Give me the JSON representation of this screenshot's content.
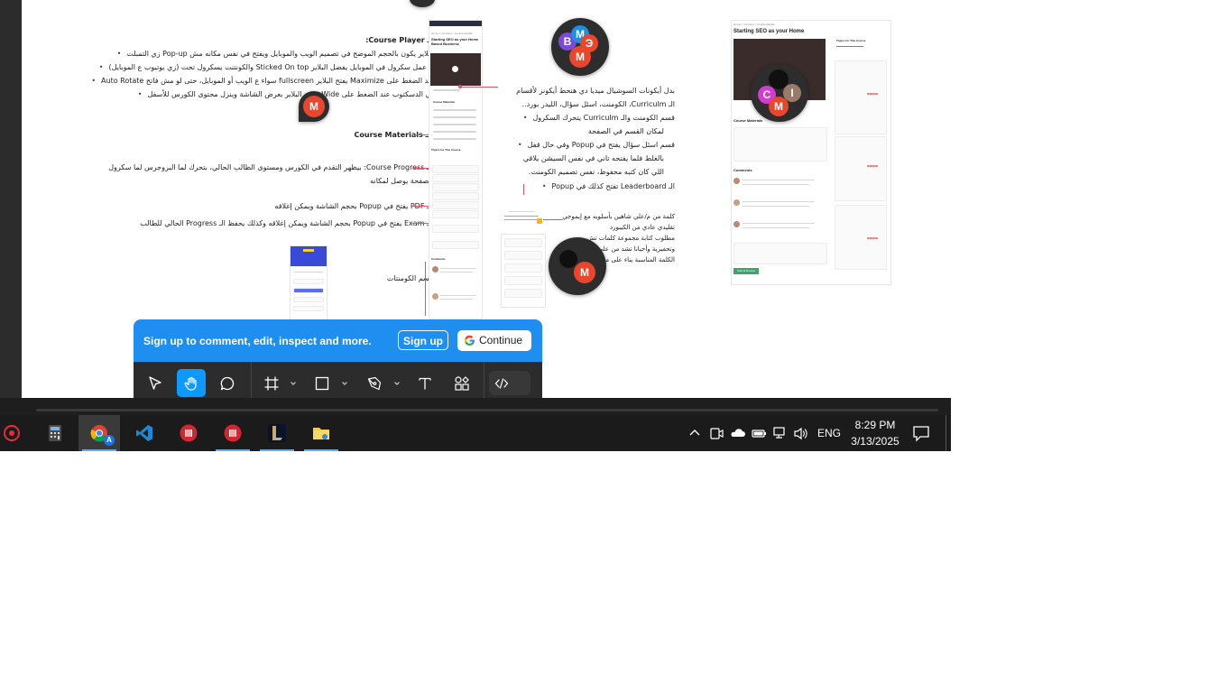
{
  "canvas": {
    "left_notes": {
      "course_player_heading": "الـ Course Player:",
      "course_player_bullets": [
        "البلاير يكون بالحجم الموضح في تصميم الويب والموبايل ويفتح في نفس مكانه مش Pop-up زي التمبلت",
        "لو عمل سكرول في الموبايل يفضل البلاير Sticked On top والكونتنت يسكرول تحت (زي يوتيوب ع الموبايل)",
        "عند الضغط على Maximize يفتح البلاير fullscreen سواء ع الويب أو الموبايل، حتى لو مش فاتح Auto Rotate",
        "في الدسكتوب عند الضغط على Wide يخلي البلاير بعرض الشاشة وينزل محتوى الكورس للأسفل"
      ],
      "course_materials": "الـ Course Materials",
      "course_progress_line1": "الـ Course Progress: بيظهر التقدم في الكورس ومستوى الطالب الحالي، بتحرك لما البروجرس لما سكرول",
      "course_progress_line2": "الصفحة يوصل لمكانه",
      "pdf_note": "الـ PDF يفتح في Popup بحجم الشاشة ويمكن إغلاقه",
      "exam_note": "الـ Exam يفتح في Popup بحجم الشاشة ويمكن إغلاقه وكذلك يحفظ الـ Progress الحالي للطالب",
      "comments_section": "قسم الكومنتات"
    },
    "right_notes": {
      "intro_line1": "بدل أيكونات السوشيال ميديا دي هنحط أيكونز لأقسام",
      "intro_line2": "الـ Curriculm، الكومنت، اسئل سؤال، الليدر بورد..",
      "bullets": [
        "قسم الكومنت والـ Curriculm يتحرك السكرول",
        "لمكان القسم في الصفحة",
        "قسم اسئل سؤال يفتح في Popup وفي حال قفل",
        "بالغلط فلما يفتحه تاني في نفس السيشن يلاقي",
        "اللي كان كتبه محفوظ، نفس تصميم الكومنت.",
        "الـ Leaderboard تفتح كذلك في Popup"
      ],
      "badge_note_line1": "كلمة من م/علي شاهين بأسلوبه مع إيموجي",
      "badge_note_line2": "تقليدي عادي من الكيبورد",
      "badge_note_line3": "مطلوب كتابة مجموعة كلمات تش...",
      "badge_note_line4": "وتحفيزية وأحيانا تشد من علي...",
      "badge_note_line5": "الكلمة المناسبة بناء على مت..."
    },
    "mockup_phone": {
      "breadcrumb": "Home > Courses > Course Details",
      "title": "Starting SEO as your Home Based Business",
      "materials": "Course Materials",
      "topics": "Topics for This Course",
      "comments": "Comments"
    },
    "mockup_desktop": {
      "breadcrumb": "Home > Courses > Course Details",
      "title": "Starting SEO as your Home",
      "topics": "Topics for This Course",
      "materials": "Course Materials",
      "comments": "Comments",
      "submit": "Submit Review"
    },
    "collaborators": [
      {
        "group": "top",
        "initials": [
          "B",
          "M",
          "Э",
          "M"
        ]
      },
      {
        "group": "left",
        "initials": [
          "M"
        ]
      },
      {
        "group": "desktop",
        "initials": [
          "C",
          "I",
          "M"
        ]
      },
      {
        "group": "bottom",
        "initials": [
          "M"
        ]
      }
    ]
  },
  "signup_banner": {
    "text": "Sign up to comment, edit, inspect and more.",
    "signup_label": "Sign up",
    "continue_label": "Continue"
  },
  "toolbar": {
    "tools": [
      "move-tool",
      "hand-tool",
      "comment-tool",
      "frame-tool",
      "shape-tool",
      "pen-tool",
      "text-tool",
      "resources-tool",
      "dev-mode-toggle"
    ],
    "active": "hand-tool"
  },
  "taskbar": {
    "apps": [
      "security-app",
      "calculator",
      "chrome",
      "vs-code",
      "app-red-1",
      "app-red-2",
      "league-of-legends",
      "file-explorer"
    ],
    "lang": "ENG",
    "time": "8:29 PM",
    "date": "3/13/2025"
  },
  "colors": {
    "accent_blue": "#1e8ef0",
    "toolbar_bg": "#2c2c2c",
    "annotation_red": "#e2526b",
    "avatar_red": "#e8472d"
  }
}
